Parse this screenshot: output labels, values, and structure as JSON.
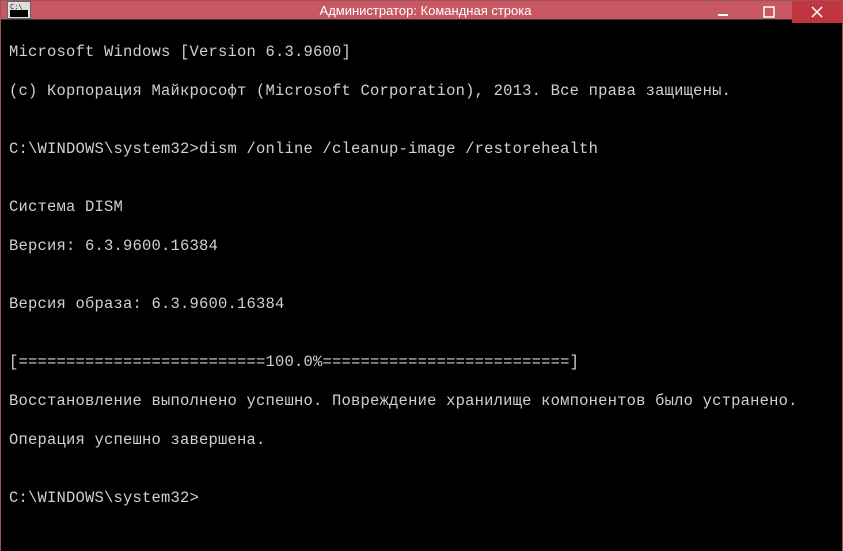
{
  "window": {
    "title": "Администратор: Командная строка"
  },
  "console": {
    "lines": [
      "Microsoft Windows [Version 6.3.9600]",
      "(c) Корпорация Майкрософт (Microsoft Corporation), 2013. Все права защищены.",
      "",
      "C:\\WINDOWS\\system32>dism /online /cleanup-image /restorehealth",
      "",
      "Cистема DISM",
      "Версия: 6.3.9600.16384",
      "",
      "Версия образа: 6.3.9600.16384",
      "",
      "[==========================100.0%==========================]",
      "Восстановление выполнено успешно. Повреждение хранилище компонентов было устранено.",
      "Операция успешно завершена.",
      "",
      "C:\\WINDOWS\\system32>"
    ]
  }
}
